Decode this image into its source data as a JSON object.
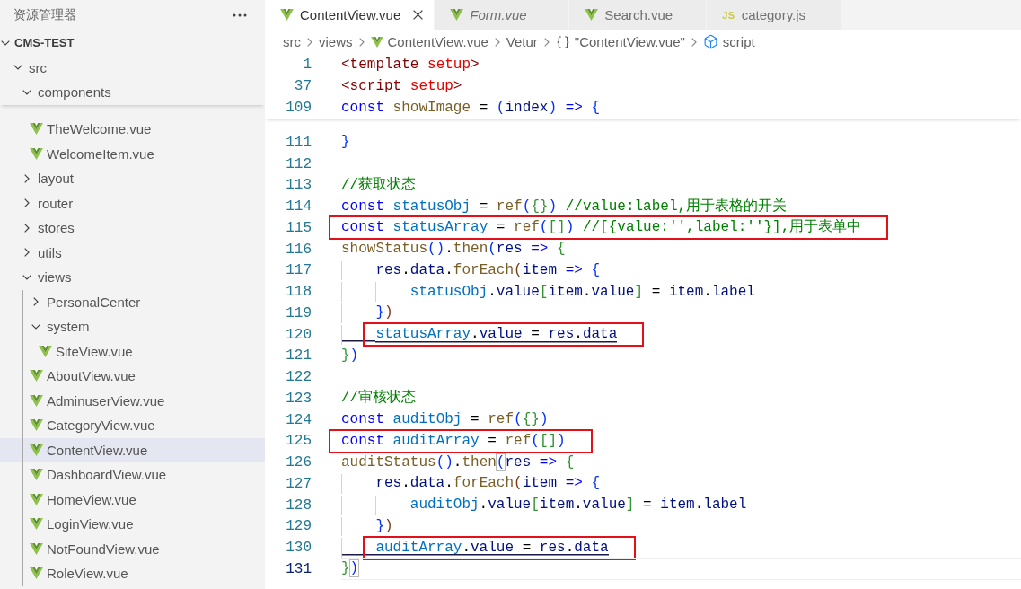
{
  "explorer": {
    "title": "资源管理器",
    "tree": [
      {
        "label": "CMS-TEST",
        "kind": "folder",
        "expanded": true,
        "selected": false,
        "children": [
          {
            "label": "src",
            "kind": "folder",
            "expanded": true,
            "selected": false,
            "children": [
              {
                "label": "components",
                "kind": "folder",
                "expanded": true,
                "selected": false,
                "children": [
                  {
                    "label": "TheWelcome.vue",
                    "kind": "vue",
                    "selected": false
                  },
                  {
                    "label": "WelcomeItem.vue",
                    "kind": "vue",
                    "selected": false
                  }
                ]
              },
              {
                "label": "layout",
                "kind": "folder",
                "expanded": false,
                "selected": false
              },
              {
                "label": "router",
                "kind": "folder",
                "expanded": false,
                "selected": false
              },
              {
                "label": "stores",
                "kind": "folder",
                "expanded": false,
                "selected": false
              },
              {
                "label": "utils",
                "kind": "folder",
                "expanded": false,
                "selected": false
              },
              {
                "label": "views",
                "kind": "folder",
                "expanded": true,
                "selected": false,
                "children": [
                  {
                    "label": "PersonalCenter",
                    "kind": "folder",
                    "expanded": false,
                    "selected": false
                  },
                  {
                    "label": "system",
                    "kind": "folder",
                    "expanded": true,
                    "selected": false,
                    "children": [
                      {
                        "label": "SiteView.vue",
                        "kind": "vue",
                        "selected": false
                      }
                    ]
                  },
                  {
                    "label": "AboutView.vue",
                    "kind": "vue",
                    "selected": false
                  },
                  {
                    "label": "AdminuserView.vue",
                    "kind": "vue",
                    "selected": false
                  },
                  {
                    "label": "CategoryView.vue",
                    "kind": "vue",
                    "selected": false
                  },
                  {
                    "label": "ContentView.vue",
                    "kind": "vue",
                    "selected": true
                  },
                  {
                    "label": "DashboardView.vue",
                    "kind": "vue",
                    "selected": false
                  },
                  {
                    "label": "HomeView.vue",
                    "kind": "vue",
                    "selected": false
                  },
                  {
                    "label": "LoginView.vue",
                    "kind": "vue",
                    "selected": false
                  },
                  {
                    "label": "NotFoundView.vue",
                    "kind": "vue",
                    "selected": false
                  },
                  {
                    "label": "RoleView.vue",
                    "kind": "vue",
                    "selected": false
                  }
                ]
              }
            ]
          }
        ]
      }
    ]
  },
  "tabs": [
    {
      "label": "ContentView.vue",
      "kind": "vue",
      "selected": true,
      "preview": false
    },
    {
      "label": "Form.vue",
      "kind": "vue",
      "selected": false,
      "preview": true
    },
    {
      "label": "Search.vue",
      "kind": "vue",
      "selected": false,
      "preview": false
    },
    {
      "label": "category.js",
      "kind": "js",
      "icon_text": "JS",
      "selected": false,
      "preview": false
    }
  ],
  "breadcrumb": [
    {
      "label": "src",
      "kind": "folder"
    },
    {
      "label": "views",
      "kind": "folder"
    },
    {
      "label": "ContentView.vue",
      "kind": "file"
    },
    {
      "label": "Vetur",
      "kind": "language"
    },
    {
      "label": "\"ContentView.vue\"",
      "kind": "module"
    },
    {
      "label": "script",
      "kind": "element"
    }
  ],
  "sticky_lines": [
    {
      "number": "1",
      "tokens": [
        {
          "text": "<template",
          "kind": "tag"
        },
        {
          "text": " setup",
          "kind": "attribute"
        },
        {
          "text": ">",
          "kind": "tag"
        }
      ]
    },
    {
      "number": "37",
      "tokens": [
        {
          "text": "<script",
          "kind": "tag"
        },
        {
          "text": " setup",
          "kind": "attribute"
        },
        {
          "text": ">",
          "kind": "tag"
        }
      ]
    },
    {
      "number": "109",
      "tokens": [
        {
          "text": "const",
          "kind": "keyword"
        },
        {
          "text": " showImage",
          "kind": "function"
        },
        {
          "text": " = ",
          "kind": "plain"
        },
        {
          "text": "(",
          "kind": "bracket1"
        },
        {
          "text": "index",
          "kind": "variable"
        },
        {
          "text": ")",
          "kind": "bracket1"
        },
        {
          "text": " => ",
          "kind": "keyword"
        },
        {
          "text": "{",
          "kind": "bracket1"
        }
      ]
    }
  ],
  "lines": [
    {
      "number": "111",
      "boxed": false,
      "underlined": false,
      "current": false,
      "tokens": [
        {
          "text": "}",
          "kind": "bracket1"
        }
      ]
    },
    {
      "number": "112",
      "current": false
    },
    {
      "number": "113",
      "boxed": false,
      "underlined": false,
      "current": false,
      "tokens": [
        {
          "text": "//获取状态",
          "kind": "comment"
        }
      ]
    },
    {
      "number": "114",
      "boxed": false,
      "underlined": false,
      "current": false,
      "tokens": [
        {
          "text": "const",
          "kind": "keyword"
        },
        {
          "text": " statusObj",
          "kind": "constant"
        },
        {
          "text": " = ",
          "kind": "plain"
        },
        {
          "text": "ref",
          "kind": "function"
        },
        {
          "text": "(",
          "kind": "bracket1"
        },
        {
          "text": "{}",
          "kind": "bracket2"
        },
        {
          "text": ")",
          "kind": "bracket1"
        },
        {
          "text": " //value:label,用于表格的开关",
          "kind": "comment"
        }
      ]
    },
    {
      "number": "115",
      "boxed": true,
      "underlined": false,
      "current": false,
      "tokens": [
        {
          "text": "const",
          "kind": "keyword"
        },
        {
          "text": " statusArray",
          "kind": "constant"
        },
        {
          "text": " = ",
          "kind": "plain"
        },
        {
          "text": "ref",
          "kind": "function"
        },
        {
          "text": "(",
          "kind": "bracket1"
        },
        {
          "text": "[]",
          "kind": "bracket2"
        },
        {
          "text": ")",
          "kind": "bracket1"
        },
        {
          "text": " //[{value:'',label:''}],用于表单中",
          "kind": "comment"
        }
      ]
    },
    {
      "number": "116",
      "boxed": false,
      "underlined": false,
      "current": false,
      "tokens": [
        {
          "text": "showStatus",
          "kind": "function"
        },
        {
          "text": "()",
          "kind": "bracket1"
        },
        {
          "text": ".",
          "kind": "plain"
        },
        {
          "text": "then",
          "kind": "function"
        },
        {
          "text": "(",
          "kind": "bracket1"
        },
        {
          "text": "res",
          "kind": "variable"
        },
        {
          "text": " => ",
          "kind": "keyword"
        },
        {
          "text": "{",
          "kind": "bracket2"
        }
      ]
    },
    {
      "number": "117",
      "boxed": false,
      "underlined": false,
      "current": false,
      "tokens": [
        {
          "text": "    res",
          "kind": "variable"
        },
        {
          "text": ".",
          "kind": "plain"
        },
        {
          "text": "data",
          "kind": "variable"
        },
        {
          "text": ".",
          "kind": "plain"
        },
        {
          "text": "forEach",
          "kind": "function"
        },
        {
          "text": "(",
          "kind": "bracket3"
        },
        {
          "text": "item",
          "kind": "variable"
        },
        {
          "text": " => ",
          "kind": "keyword"
        },
        {
          "text": "{",
          "kind": "bracket1"
        }
      ]
    },
    {
      "number": "118",
      "boxed": false,
      "underlined": false,
      "current": false,
      "tokens": [
        {
          "text": "        statusObj",
          "kind": "constant"
        },
        {
          "text": ".",
          "kind": "plain"
        },
        {
          "text": "value",
          "kind": "variable"
        },
        {
          "text": "[",
          "kind": "bracket2"
        },
        {
          "text": "item",
          "kind": "variable"
        },
        {
          "text": ".",
          "kind": "plain"
        },
        {
          "text": "value",
          "kind": "variable"
        },
        {
          "text": "]",
          "kind": "bracket2"
        },
        {
          "text": " = ",
          "kind": "plain"
        },
        {
          "text": "item",
          "kind": "variable"
        },
        {
          "text": ".",
          "kind": "plain"
        },
        {
          "text": "label",
          "kind": "variable"
        }
      ]
    },
    {
      "number": "119",
      "boxed": false,
      "underlined": false,
      "current": false,
      "tokens": [
        {
          "text": "    }",
          "kind": "bracket1"
        },
        {
          "text": ")",
          "kind": "bracket3"
        }
      ]
    },
    {
      "number": "120",
      "boxed": true,
      "underlined": true,
      "current": false,
      "tokens": [
        {
          "text": "    statusArray",
          "kind": "constant"
        },
        {
          "text": ".",
          "kind": "plain"
        },
        {
          "text": "value",
          "kind": "variable"
        },
        {
          "text": " = ",
          "kind": "plain"
        },
        {
          "text": "res",
          "kind": "variable"
        },
        {
          "text": ".",
          "kind": "plain"
        },
        {
          "text": "data",
          "kind": "variable"
        }
      ]
    },
    {
      "number": "121",
      "boxed": false,
      "underlined": false,
      "current": false,
      "tokens": [
        {
          "text": "}",
          "kind": "bracket2"
        },
        {
          "text": ")",
          "kind": "bracket1"
        }
      ]
    },
    {
      "number": "122",
      "current": false
    },
    {
      "number": "123",
      "boxed": false,
      "underlined": false,
      "current": false,
      "tokens": [
        {
          "text": "//审核状态",
          "kind": "comment"
        }
      ]
    },
    {
      "number": "124",
      "boxed": false,
      "underlined": false,
      "current": false,
      "tokens": [
        {
          "text": "const",
          "kind": "keyword"
        },
        {
          "text": " auditObj",
          "kind": "constant"
        },
        {
          "text": " = ",
          "kind": "plain"
        },
        {
          "text": "ref",
          "kind": "function"
        },
        {
          "text": "(",
          "kind": "bracket1"
        },
        {
          "text": "{}",
          "kind": "bracket2"
        },
        {
          "text": ")",
          "kind": "bracket1"
        }
      ]
    },
    {
      "number": "125",
      "boxed": true,
      "underlined": false,
      "current": false,
      "tokens": [
        {
          "text": "const",
          "kind": "keyword"
        },
        {
          "text": " auditArray",
          "kind": "constant"
        },
        {
          "text": " = ",
          "kind": "plain"
        },
        {
          "text": "ref",
          "kind": "function"
        },
        {
          "text": "(",
          "kind": "bracket1"
        },
        {
          "text": "[]",
          "kind": "bracket2"
        },
        {
          "text": ")",
          "kind": "bracket1"
        }
      ]
    },
    {
      "number": "126",
      "boxed": false,
      "underlined": false,
      "current": false,
      "tokens": [
        {
          "text": "auditStatus",
          "kind": "function"
        },
        {
          "text": "()",
          "kind": "bracket1"
        },
        {
          "text": ".",
          "kind": "plain"
        },
        {
          "text": "then",
          "kind": "function"
        },
        {
          "text": "(",
          "kind": "match"
        },
        {
          "text": "res",
          "kind": "variable"
        },
        {
          "text": " => ",
          "kind": "keyword"
        },
        {
          "text": "{",
          "kind": "bracket2"
        }
      ]
    },
    {
      "number": "127",
      "boxed": false,
      "underlined": false,
      "current": false,
      "tokens": [
        {
          "text": "    res",
          "kind": "variable"
        },
        {
          "text": ".",
          "kind": "plain"
        },
        {
          "text": "data",
          "kind": "variable"
        },
        {
          "text": ".",
          "kind": "plain"
        },
        {
          "text": "forEach",
          "kind": "function"
        },
        {
          "text": "(",
          "kind": "bracket3"
        },
        {
          "text": "item",
          "kind": "variable"
        },
        {
          "text": " => ",
          "kind": "keyword"
        },
        {
          "text": "{",
          "kind": "bracket1"
        }
      ]
    },
    {
      "number": "128",
      "boxed": false,
      "underlined": false,
      "current": false,
      "tokens": [
        {
          "text": "        auditObj",
          "kind": "constant"
        },
        {
          "text": ".",
          "kind": "plain"
        },
        {
          "text": "value",
          "kind": "variable"
        },
        {
          "text": "[",
          "kind": "bracket2"
        },
        {
          "text": "item",
          "kind": "variable"
        },
        {
          "text": ".",
          "kind": "plain"
        },
        {
          "text": "value",
          "kind": "variable"
        },
        {
          "text": "]",
          "kind": "bracket2"
        },
        {
          "text": " = ",
          "kind": "plain"
        },
        {
          "text": "item",
          "kind": "variable"
        },
        {
          "text": ".",
          "kind": "plain"
        },
        {
          "text": "label",
          "kind": "variable"
        }
      ]
    },
    {
      "number": "129",
      "boxed": false,
      "underlined": false,
      "current": false,
      "tokens": [
        {
          "text": "    }",
          "kind": "bracket1"
        },
        {
          "text": ")",
          "kind": "bracket3"
        }
      ]
    },
    {
      "number": "130",
      "boxed": true,
      "underlined": true,
      "current": false,
      "tokens": [
        {
          "text": "    auditArray",
          "kind": "constant"
        },
        {
          "text": ".",
          "kind": "plain"
        },
        {
          "text": "value",
          "kind": "variable"
        },
        {
          "text": " = ",
          "kind": "plain"
        },
        {
          "text": "res",
          "kind": "variable"
        },
        {
          "text": ".",
          "kind": "plain"
        },
        {
          "text": "data",
          "kind": "variable"
        }
      ]
    },
    {
      "number": "131",
      "boxed": false,
      "underlined": false,
      "current": true,
      "tokens": [
        {
          "text": "}",
          "kind": "bracket2"
        },
        {
          "text": ")",
          "kind": "match"
        }
      ]
    }
  ]
}
